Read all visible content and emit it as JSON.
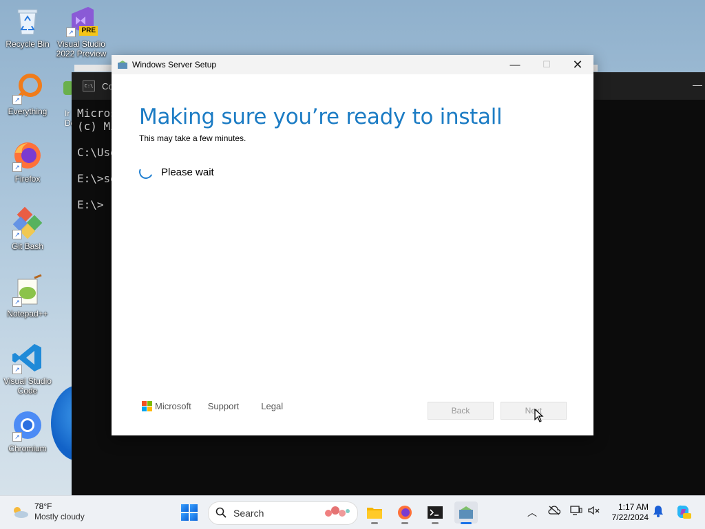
{
  "desktop": {
    "icons": [
      {
        "label": "Recycle Bin"
      },
      {
        "label": "Visual Studio 2022 Preview",
        "badge": "PRE"
      },
      {
        "label": "Everything"
      },
      {
        "label": "Firefox"
      },
      {
        "label": "Git Bash"
      },
      {
        "label": "Notepad++"
      },
      {
        "label": "Visual Studio Code"
      },
      {
        "label": "Chromium"
      }
    ],
    "partial_icon_text": {
      "line1": "Ir",
      "line2": "Do"
    }
  },
  "console": {
    "title": "Co",
    "lines": [
      "Micros",
      "(c) Mi",
      "",
      "C:\\Use",
      "",
      "E:\\>se",
      "",
      "E:\\>"
    ]
  },
  "setup": {
    "title": "Windows Server Setup",
    "heading": "Making sure you’re ready to install",
    "subheading": "This may take a few minutes.",
    "status": "Please wait",
    "footer": {
      "brand": "Microsoft",
      "support": "Support",
      "legal": "Legal"
    },
    "buttons": {
      "back": "Back",
      "next": "Next"
    }
  },
  "taskbar": {
    "weather": {
      "temp": "78°F",
      "condition": "Mostly cloudy"
    },
    "search_placeholder": "Search",
    "clock": {
      "time": "1:17 AM",
      "date": "7/22/2024"
    },
    "apps": [
      "file-explorer",
      "firefox",
      "terminal",
      "windows-server-setup"
    ]
  },
  "colors": {
    "accent": "#1c7cc4",
    "taskbar_bg": "#eef1f5",
    "console_bg": "#0c0c0c"
  }
}
